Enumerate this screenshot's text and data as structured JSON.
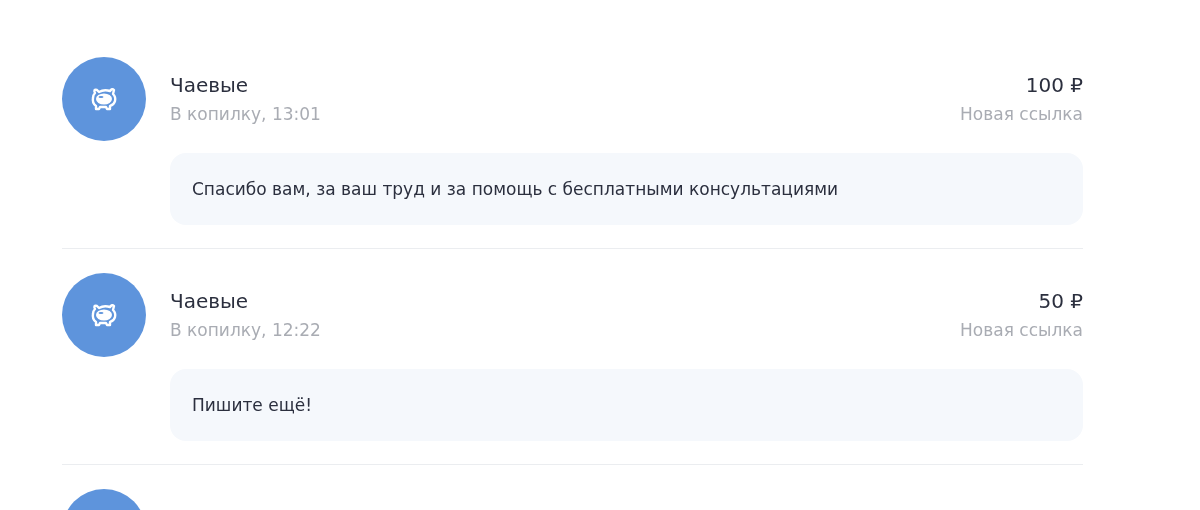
{
  "items": [
    {
      "kind": "full",
      "title": "Чаевые",
      "subtitle": "В копилку, 13:01",
      "amount": "100 ₽",
      "source": "Новая ссылка",
      "message": "Спасибо вам, за ваш труд и за помощь с бесплатными консультациями"
    },
    {
      "kind": "full",
      "title": "Чаевые",
      "subtitle": "В копилку, 12:22",
      "amount": "50 ₽",
      "source": "Новая ссылка",
      "message": "Пишите ещё!"
    },
    {
      "kind": "cut"
    }
  ]
}
